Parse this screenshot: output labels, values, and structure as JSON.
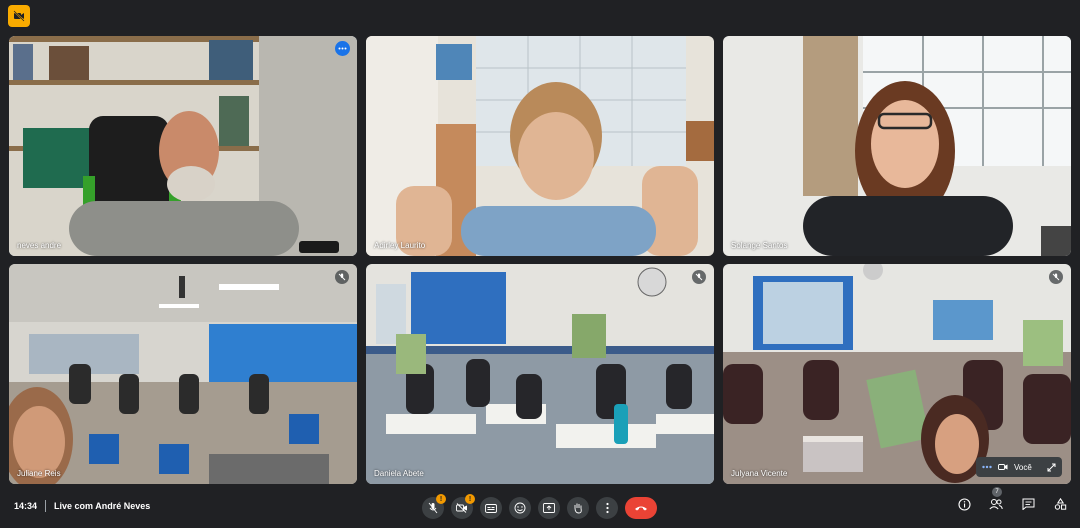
{
  "top": {
    "icon": "camera-off-icon"
  },
  "participants": [
    {
      "name": "neves andre",
      "active": true,
      "indicator": "more-options-icon"
    },
    {
      "name": "Adirley Laurito",
      "active": false,
      "indicator": ""
    },
    {
      "name": "Solange Santos",
      "active": false,
      "indicator": ""
    },
    {
      "name": "Juliane Reis",
      "active": false,
      "indicator": "mic-off-icon"
    },
    {
      "name": "Daniela Abete",
      "active": false,
      "indicator": "mic-off-icon"
    },
    {
      "name": "Julyana Vicente",
      "active": false,
      "indicator": "mic-off-icon"
    }
  ],
  "self": {
    "label": "Você"
  },
  "bottom": {
    "time": "14:34",
    "meeting_title": "Live com André Neves",
    "controls": [
      {
        "icon": "mic-off-icon",
        "warning": "!"
      },
      {
        "icon": "camera-off-icon",
        "warning": "!"
      },
      {
        "icon": "captions-icon"
      },
      {
        "icon": "emoji-icon"
      },
      {
        "icon": "present-screen-icon"
      },
      {
        "icon": "raise-hand-icon"
      },
      {
        "icon": "more-vert-icon"
      },
      {
        "icon": "hangup-icon"
      }
    ],
    "right_controls": [
      {
        "icon": "info-icon"
      },
      {
        "icon": "people-icon",
        "count": "7"
      },
      {
        "icon": "chat-icon"
      },
      {
        "icon": "activities-icon"
      }
    ]
  },
  "colors": {
    "background": "#202124",
    "accent": "#8ab4f8",
    "hangup": "#ea4335",
    "warning": "#f29900"
  }
}
